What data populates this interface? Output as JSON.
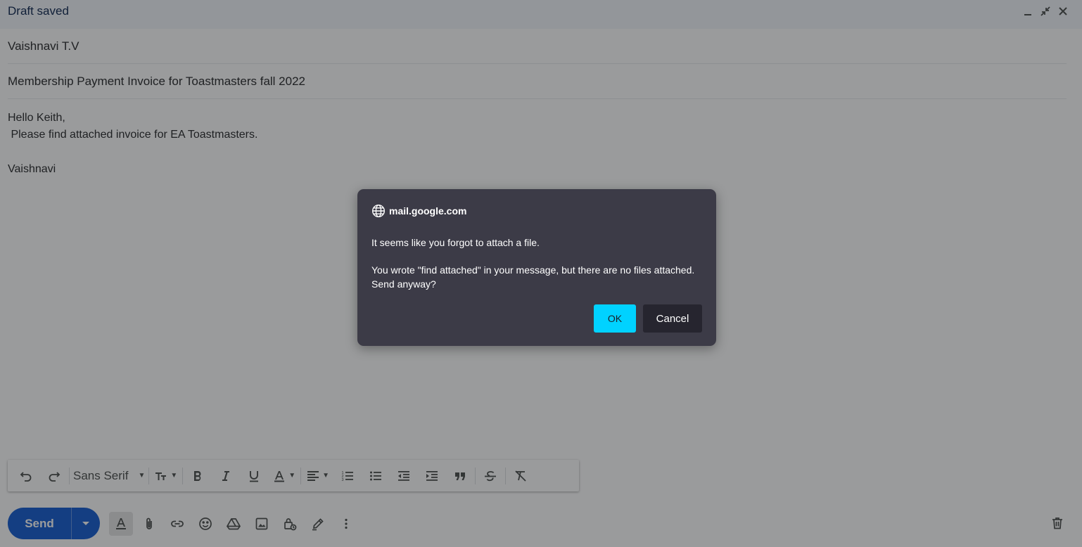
{
  "header": {
    "title": "Draft saved"
  },
  "compose": {
    "to": "Vaishnavi T.V",
    "subject": "Membership Payment Invoice for Toastmasters fall 2022",
    "body": {
      "greeting": "Hello Keith,",
      "line": " Please find attached invoice for EA Toastmasters.",
      "blank": "",
      "signature": "Vaishnavi"
    }
  },
  "toolbar": {
    "font_family": "Sans Serif"
  },
  "send": {
    "label": "Send"
  },
  "dialog": {
    "origin": "mail.google.com",
    "message": "It seems like you forgot to attach a file.",
    "detail": "You wrote \"find attached\" in your message, but there are no files attached. Send anyway?",
    "ok_label": "OK",
    "cancel_label": "Cancel"
  },
  "colors": {
    "send_button": "#0b57d0",
    "dialog_background": "#3c3b47",
    "ok_button": "#00d2ff",
    "cancel_button": "#26252f",
    "header_background": "#f2f6fc"
  },
  "icons": {
    "window": [
      "minimize-icon",
      "exit-fullscreen-icon",
      "close-icon"
    ],
    "toolbar": [
      "undo-icon",
      "redo-icon",
      "text-size-icon",
      "bold-icon",
      "italic-icon",
      "underline-icon",
      "text-color-icon",
      "align-icon",
      "numbered-list-icon",
      "bulleted-list-icon",
      "indent-less-icon",
      "indent-more-icon",
      "quote-icon",
      "strikethrough-icon",
      "remove-formatting-icon"
    ],
    "bottom": [
      "formatting-options-icon",
      "attach-icon",
      "link-icon",
      "emoji-icon",
      "drive-icon",
      "photo-icon",
      "confidential-mode-icon",
      "signature-icon",
      "more-options-icon",
      "trash-icon"
    ],
    "dialog": [
      "globe-icon"
    ]
  }
}
